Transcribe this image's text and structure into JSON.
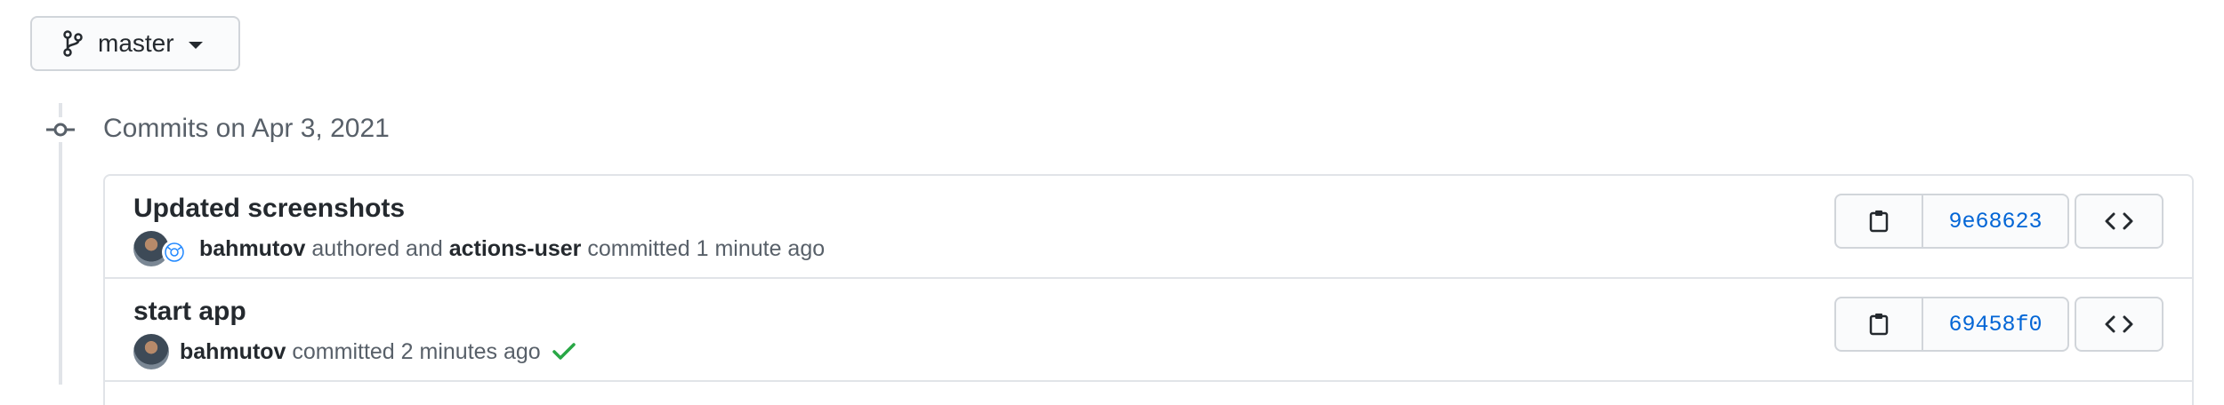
{
  "branch": {
    "name": "master",
    "icon": "git-branch-icon"
  },
  "group": {
    "title": "Commits on Apr 3, 2021",
    "icon": "git-commit-icon"
  },
  "commits": [
    {
      "title": "Updated screenshots",
      "author": "bahmutov",
      "authored_text": "authored and",
      "committer": "actions-user",
      "committed_text": "committed 1 minute ago",
      "sha": "9e68623",
      "status": ""
    },
    {
      "title": "start app",
      "author": "bahmutov",
      "committed_text": "committed 2 minutes ago",
      "sha": "69458f0",
      "status": "success"
    }
  ],
  "icons": {
    "copy": "clippy-icon",
    "browse": "code-icon",
    "status_success": "check-icon"
  },
  "colors": {
    "link": "#0366d6",
    "success": "#28a745",
    "muted": "#586069",
    "border": "#e1e4e8"
  }
}
